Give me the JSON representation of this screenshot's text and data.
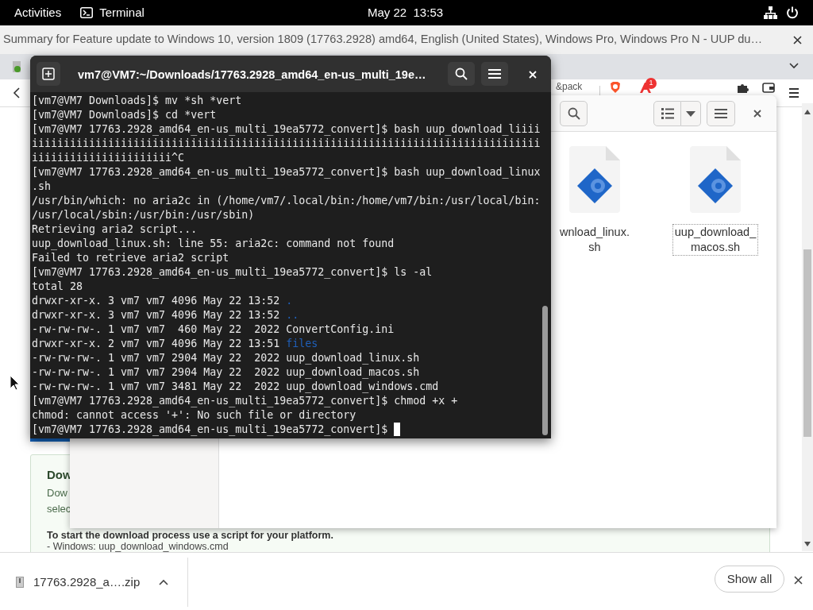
{
  "top_bar": {
    "activities": "Activities",
    "app": "Terminal",
    "clock": "May 22  13:53"
  },
  "browser": {
    "title": "Summary for Feature update to Windows 10, version 1809 (17763.2928) amd64, English (United States), Windows Pro, Windows Pro N - UUP du…",
    "bookmark_text": "&pack",
    "extension_badge": "1",
    "page": {
      "card_heading": "Dow",
      "card_lines": [
        "Dow",
        "selec"
      ],
      "instruction": "To start the download process use a script for your platform.",
      "script_line": "- Windows: uup_download_windows.cmd"
    }
  },
  "terminal": {
    "title": "vm7@VM7:~/Downloads/17763.2928_amd64_en-us_multi_19e…",
    "lines": [
      {
        "text": "[vm7@VM7 Downloads]$ mv *sh *vert"
      },
      {
        "text": "[vm7@VM7 Downloads]$ cd *vert"
      },
      {
        "text": "[vm7@VM7 17763.2928_amd64_en-us_multi_19ea5772_convert]$ bash uup_download_liiii"
      },
      {
        "text": "iiiiiiiiiiiiiiiiiiiiiiiiiiiiiiiiiiiiiiiiiiiiiiiiiiiiiiiiiiiiiiiiiiiiiiiiiiiiiiii"
      },
      {
        "text": "iiiiiiiiiiiiiiiiiiiiii^C"
      },
      {
        "text": "[vm7@VM7 17763.2928_amd64_en-us_multi_19ea5772_convert]$ bash uup_download_linux"
      },
      {
        "text": ".sh"
      },
      {
        "text": "/usr/bin/which: no aria2c in (/home/vm7/.local/bin:/home/vm7/bin:/usr/local/bin:"
      },
      {
        "text": "/usr/local/sbin:/usr/bin:/usr/sbin)"
      },
      {
        "text": "Retrieving aria2 script..."
      },
      {
        "text": "uup_download_linux.sh: line 55: aria2c: command not found"
      },
      {
        "text": "Failed to retrieve aria2 script"
      },
      {
        "text": "[vm7@VM7 17763.2928_amd64_en-us_multi_19ea5772_convert]$ ls -al"
      },
      {
        "text": "total 28"
      },
      {
        "text": "drwxr-xr-x. 3 vm7 vm7 4096 May 22 13:52 ",
        "entry": ".",
        "kind": "dir"
      },
      {
        "text": "drwxr-xr-x. 3 vm7 vm7 4096 May 22 13:52 ",
        "entry": "..",
        "kind": "dir"
      },
      {
        "text": "-rw-rw-rw-. 1 vm7 vm7  460 May 22  2022 ConvertConfig.ini"
      },
      {
        "text": "drwxr-xr-x. 2 vm7 vm7 4096 May 22 13:51 ",
        "entry": "files",
        "kind": "dir"
      },
      {
        "text": "-rw-rw-rw-. 1 vm7 vm7 2904 May 22  2022 uup_download_linux.sh"
      },
      {
        "text": "-rw-rw-rw-. 1 vm7 vm7 2904 May 22  2022 uup_download_macos.sh"
      },
      {
        "text": "-rw-rw-rw-. 1 vm7 vm7 3481 May 22  2022 uup_download_windows.cmd"
      },
      {
        "text": "[vm7@VM7 17763.2928_amd64_en-us_multi_19ea5772_convert]$ chmod +x +"
      },
      {
        "text": "chmod: cannot access '+': No such file or directory"
      },
      {
        "text": "[vm7@VM7 17763.2928_amd64_en-us_multi_19ea5772_convert]$ ",
        "cursor": true
      }
    ]
  },
  "files": {
    "items": [
      {
        "label_lines": [
          "wnload_linux.",
          "sh"
        ],
        "selected": false
      },
      {
        "label_lines": [
          "uup_download_",
          "macos.sh"
        ],
        "selected": true
      }
    ]
  },
  "downloads_bar": {
    "items": [
      {
        "name": "17763.2928_a….zip"
      }
    ],
    "show_all": "Show all"
  }
}
